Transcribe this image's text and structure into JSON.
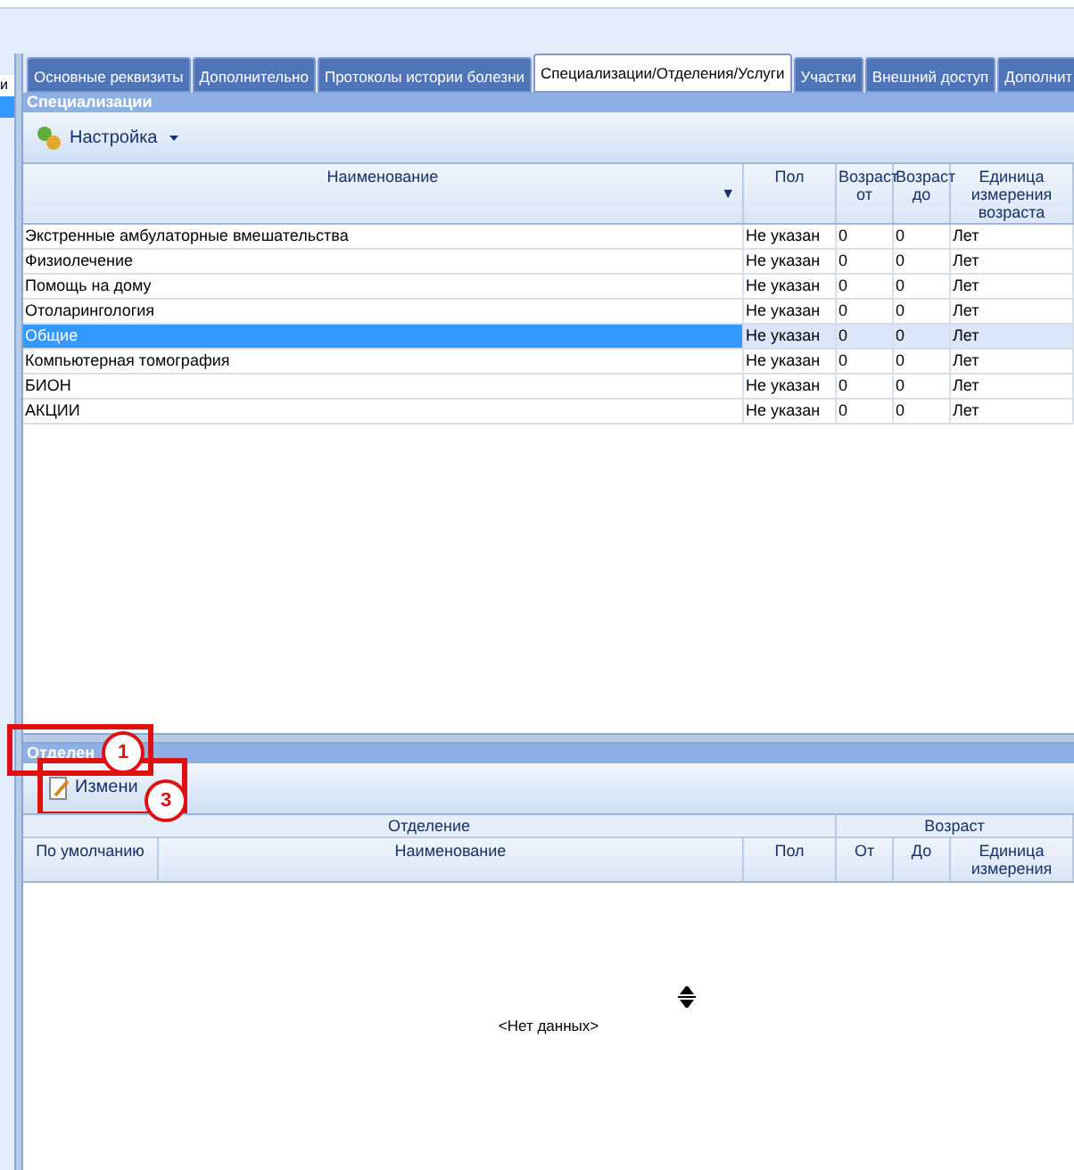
{
  "sidebar": {
    "items": [
      {
        "label": "и",
        "selected": false
      },
      {
        "selected": true
      }
    ]
  },
  "tabs": [
    {
      "label": "Основные реквизиты",
      "selected": false
    },
    {
      "label": "Дополнительно",
      "selected": false
    },
    {
      "label": "Протоколы истории болезни",
      "selected": false
    },
    {
      "label": "Специализации/Отделения/Услуги",
      "selected": true
    },
    {
      "label": "Участки",
      "selected": false
    },
    {
      "label": "Внешний доступ",
      "selected": false
    },
    {
      "label": "Дополнит",
      "selected": false
    }
  ],
  "specializations": {
    "title": "Специализации",
    "toolbar_button": "Настройка",
    "sort_icon": "▼",
    "columns": [
      "Наименование",
      "Пол",
      "Возраст от",
      "Возраст до",
      "Единица измерения возраста"
    ],
    "rows": [
      {
        "cells": [
          "Экстренные амбулаторные вмешательства",
          "Не указан",
          "0",
          "0",
          "Лет"
        ],
        "selected": false
      },
      {
        "cells": [
          "Физиолечение",
          "Не указан",
          "0",
          "0",
          "Лет"
        ],
        "selected": false
      },
      {
        "cells": [
          "Помощь на дому",
          "Не указан",
          "0",
          "0",
          "Лет"
        ],
        "selected": false
      },
      {
        "cells": [
          "Отоларингология",
          "Не указан",
          "0",
          "0",
          "Лет"
        ],
        "selected": false
      },
      {
        "cells": [
          "Общие",
          "Не указан",
          "0",
          "0",
          "Лет"
        ],
        "selected": true
      },
      {
        "cells": [
          "Компьютерная томография",
          "Не указан",
          "0",
          "0",
          "Лет"
        ],
        "selected": false
      },
      {
        "cells": [
          "БИОН",
          "Не указан",
          "0",
          "0",
          "Лет"
        ],
        "selected": false
      },
      {
        "cells": [
          "АКЦИИ",
          "Не указан",
          "0",
          "0",
          "Лет"
        ],
        "selected": false
      }
    ]
  },
  "departments": {
    "title": "Отделен",
    "toolbar_button": "Измени",
    "column_groups": [
      "Отделение",
      "Возраст"
    ],
    "columns": [
      "По умолчанию",
      "Наименование",
      "Пол",
      "От",
      "До",
      "Единица измерения"
    ],
    "empty_text": "<Нет данных>"
  },
  "annotations": [
    {
      "label": "1"
    },
    {
      "label": "3"
    }
  ]
}
